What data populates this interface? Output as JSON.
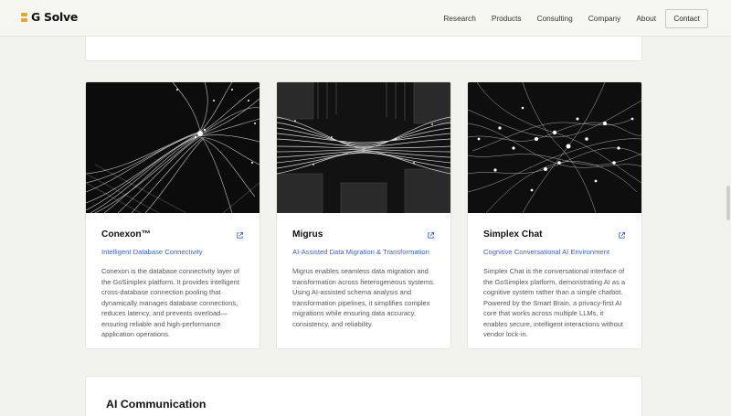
{
  "brand": {
    "logo_text": "G Solve",
    "accent": "#e7a722"
  },
  "nav": {
    "links": [
      "Research",
      "Products",
      "Consulting",
      "Company",
      "About"
    ],
    "contact_label": "Contact"
  },
  "products": [
    {
      "title": "Conexon™",
      "subtitle": "Intelligent Database Connectivity",
      "description": "Conexon is the database connectivity layer of the GoSimplex platform. It provides intelligent cross-database connection pooling that dynamically manages database connections, reduces latency, and prevents overload—ensuring reliable and high-performance application operations."
    },
    {
      "title": "Migrus",
      "subtitle": "AI-Assisted Data Migration & Transformation",
      "description": "Migrus enables seamless data migration and transformation across heterogeneous systems. Using AI-assisted schema analysis and transformation pipelines, it simplifies complex migrations while ensuring data accuracy, consistency, and reliability."
    },
    {
      "title": "Simplex Chat",
      "subtitle": "Cognitive Conversational AI Environment",
      "description": "Simplex Chat is the conversational interface of the GoSimplex platform, demonstrating AI as a cognitive system rather than a simple chatbot. Powered by the Smart Brain, a privacy-first AI core that works across multiple LLMs, it enables secure, intelligent interactions without vendor lock-in."
    }
  ],
  "section": {
    "title": "AI Communication"
  },
  "colors": {
    "link_blue": "#3d63d2",
    "page_bg": "#f3f3ee"
  }
}
